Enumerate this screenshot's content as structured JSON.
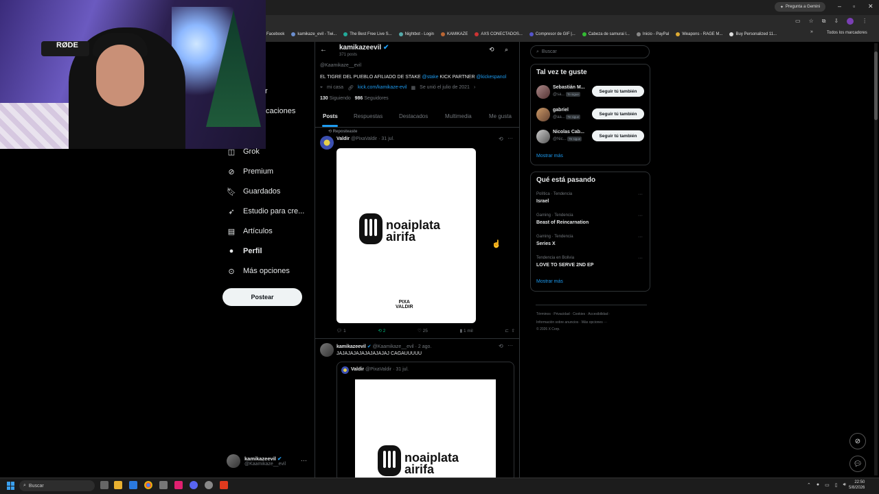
{
  "browser": {
    "gemini_label": "Pregunta a Gemini",
    "bookmarks": [
      "Facebook",
      "kamikaze_evil - Twi...",
      "The Best Free Live S...",
      "Nightbot - Login",
      "KAMIKAZE",
      "AXS CONECTADOS...",
      "Compresor de GIF |...",
      "Cabeza de samurai l...",
      "Inicio - PayPal",
      "Weapons - RAGE M...",
      "Buy Personalized 11..."
    ],
    "all_bookmarks": "Todos los marcadores"
  },
  "webcam": {
    "brand": "RØDE"
  },
  "nav": {
    "partial_notifications": "caciones",
    "partial_r": "r",
    "items": [
      {
        "label": "Grok",
        "icon": "grok-icon"
      },
      {
        "label": "Premium",
        "icon": "premium-icon"
      },
      {
        "label": "Guardados",
        "icon": "bookmark-icon"
      },
      {
        "label": "Estudio para cre...",
        "icon": "rocket-icon"
      },
      {
        "label": "Artículos",
        "icon": "article-icon"
      },
      {
        "label": "Perfil",
        "icon": "profile-icon"
      },
      {
        "label": "Más opciones",
        "icon": "more-circle-icon"
      }
    ],
    "post_button": "Postear",
    "account": {
      "name": "kamikazeevil",
      "handle": "@Kaamikaze__evil"
    }
  },
  "profile": {
    "header_name": "kamikazeevil",
    "header_posts": "371 posts",
    "handle": "@Kaamikaze__evil",
    "bio_text": "EL TIGRE DEL PUEBLO AFILIADO DE STAKE",
    "bio_link1": "@stake",
    "bio_mid": "KICK PARTNER",
    "bio_link2": "@kickespanol",
    "location": "mi casa",
    "website": "kick.com/kamikaze-evil",
    "joined": "Se unió el julio de 2021",
    "following_count": "130",
    "following_label": "Siguiendo",
    "followers_count": "986",
    "followers_label": "Seguidores"
  },
  "tabs": [
    "Posts",
    "Respuestas",
    "Destacados",
    "Multimedia",
    "Me gusta"
  ],
  "tweet1": {
    "repost_label": "Reposteaste",
    "name": "Valdir",
    "handle": "@PixaValdir",
    "date": "· 31 jul.",
    "logo_line1": "noaiplata",
    "logo_line2": "airifa",
    "watermark1": "PIXA",
    "watermark2": "VALDIR",
    "replies": "1",
    "reposts": "2",
    "likes": "25",
    "views": "1 mil"
  },
  "tweet2": {
    "name": "kamikazeevil",
    "handle": "@Kaamikaze__evil",
    "date": "· 2 ago.",
    "text": "JAJAJAJAJAJAJAJAJAJ CAGAUUUUU",
    "quote_name": "Valdir",
    "quote_handle": "@PixaValdir",
    "quote_date": "· 31 jul.",
    "logo_line1": "noaiplata",
    "logo_line2": "airifa"
  },
  "right": {
    "search_placeholder": "Buscar",
    "suggest_title": "Tal vez te guste",
    "suggestions": [
      {
        "name": "Sebastián M...",
        "handle": "@sa...",
        "badge": "Te sigue",
        "button": "Seguir tú también"
      },
      {
        "name": "gabriel",
        "handle": "@aa...",
        "badge": "Te sigue",
        "button": "Seguir tú también"
      },
      {
        "name": "Nicolas Cab...",
        "handle": "@Nic...",
        "badge": "Te sigue",
        "button": "Seguir tú también"
      }
    ],
    "show_more": "Mostrar más",
    "trends_title": "Qué está pasando",
    "trends": [
      {
        "context": "Política · Tendencia",
        "title": "Israel"
      },
      {
        "context": "Gaming · Tendencia",
        "title": "Beast of Reincarnation"
      },
      {
        "context": "Gaming · Tendencia",
        "title": "Series X"
      },
      {
        "context": "Tendencia en Bolivia",
        "title": "LOVE TO SERVE 2ND EP"
      }
    ],
    "trends_more": "Mostrar más",
    "footer1": "Términos · Privacidad · Cookies · Accesibilidad ·",
    "footer2": "Información sobre anuncios · Más opciones ···",
    "footer3": "© 2026 X Corp."
  },
  "taskbar": {
    "search": "Buscar",
    "time": "22:50",
    "date": "5/8/2026"
  }
}
